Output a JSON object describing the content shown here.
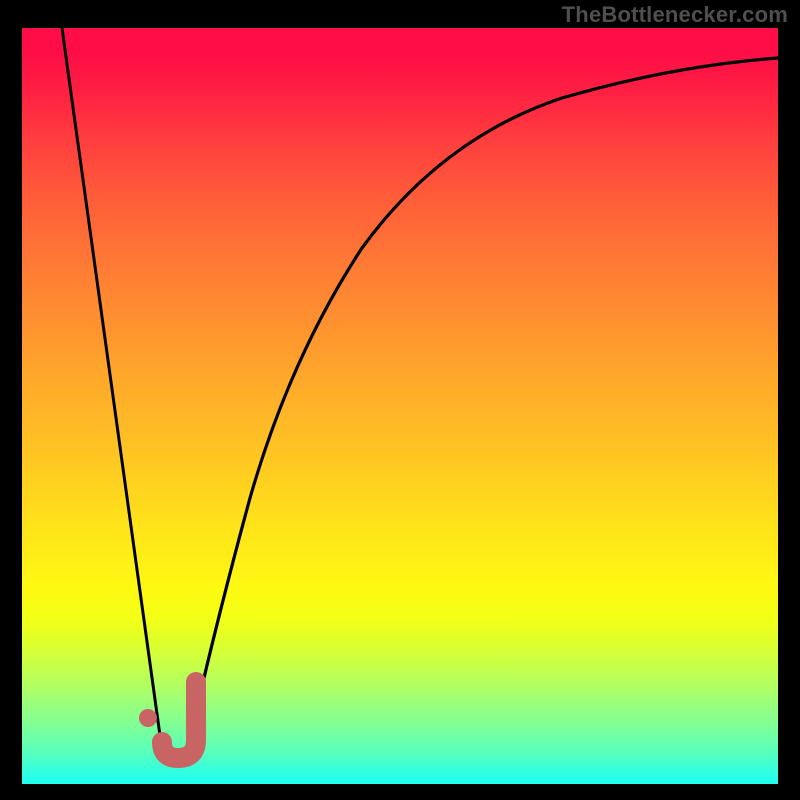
{
  "watermark": "TheBottlenecker.com",
  "colors": {
    "frame": "#000000",
    "curve": "#000000",
    "marker": "#c86464",
    "gradient_top": "#fe0d46",
    "gradient_mid": "#ffe31a",
    "gradient_bottom": "#1efff1"
  },
  "chart_data": {
    "type": "line",
    "title": "",
    "xlabel": "",
    "ylabel": "",
    "xlim": [
      0,
      100
    ],
    "ylim": [
      0,
      100
    ],
    "series": [
      {
        "name": "bottleneck-curve",
        "x": [
          5,
          10,
          15,
          18,
          20,
          22,
          25,
          30,
          35,
          40,
          45,
          50,
          55,
          60,
          70,
          80,
          90,
          100
        ],
        "y": [
          100,
          63,
          27,
          6,
          2,
          5,
          17,
          38,
          55,
          65,
          73,
          79,
          83,
          86,
          90,
          93,
          95,
          96
        ]
      }
    ],
    "annotations": [
      {
        "name": "valley-j-marker",
        "x": 21,
        "y": 4,
        "text": "J"
      },
      {
        "name": "valley-j-dot",
        "x": 17,
        "y": 9
      }
    ],
    "background": "vertical-heatmap-gradient"
  }
}
